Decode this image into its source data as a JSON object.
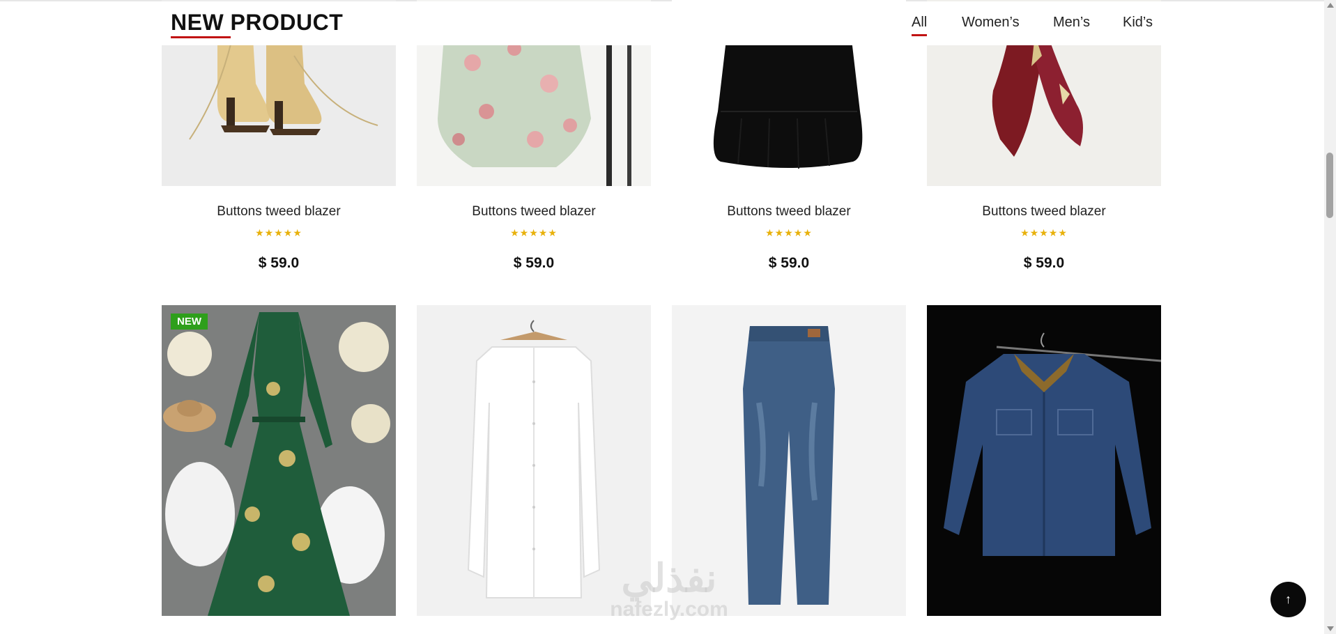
{
  "section": {
    "title": "NEW PRODUCT",
    "tabs": [
      "All",
      "Women’s",
      "Men’s",
      "Kid’s"
    ],
    "active_tab": "All"
  },
  "products_row1": [
    {
      "name": "Buttons tweed blazer",
      "rating": 5,
      "stars": "★★★★★",
      "price": "$ 59.0",
      "image": "beige-lace-up-heel-boots"
    },
    {
      "name": "Buttons tweed blazer",
      "rating": 5,
      "stars": "★★★★★",
      "price": "$ 59.0",
      "image": "floral-mint-tiered-skirt"
    },
    {
      "name": "Buttons tweed blazer",
      "rating": 5,
      "stars": "★★★★★",
      "price": "$ 59.0",
      "image": "black-tiered-skirt"
    },
    {
      "name": "Buttons tweed blazer",
      "rating": 5,
      "stars": "★★★★★",
      "price": "$ 59.0",
      "image": "burgundy-silk-scarf"
    }
  ],
  "products_row2": [
    {
      "badge": "NEW",
      "image": "green-printed-maxi-dress"
    },
    {
      "image": "white-dress-shirt-on-hanger"
    },
    {
      "image": "blue-denim-jeans"
    },
    {
      "image": "denim-jacket-corduroy-collar"
    }
  ],
  "watermark": {
    "arabic": "نفذلي",
    "latin": "nafezly.com"
  },
  "scroll_top_icon": "arrow-up-icon",
  "colors": {
    "accent_red": "#c11313",
    "star_gold": "#e8b10b",
    "badge_green": "#2e9f1b",
    "button_black": "#0a0a0a"
  }
}
